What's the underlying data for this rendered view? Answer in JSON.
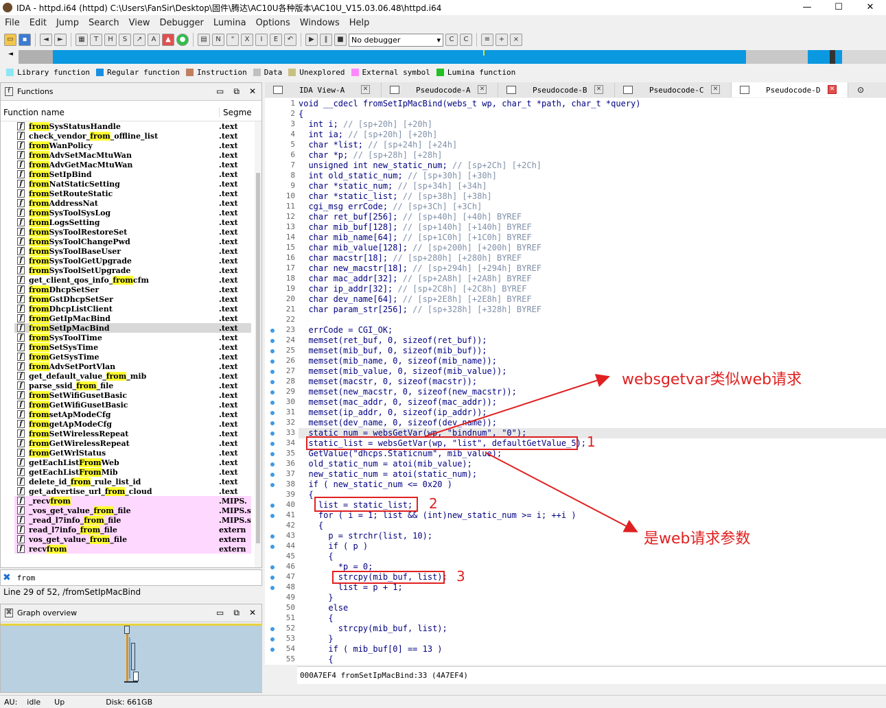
{
  "window": {
    "title": "IDA - httpd.i64 (httpd) C:\\Users\\FanSir\\Desktop\\固件\\腾达\\AC10U各种版本\\AC10U_V15.03.06.48\\httpd.i64"
  },
  "menu": [
    "File",
    "Edit",
    "Jump",
    "Search",
    "View",
    "Debugger",
    "Lumina",
    "Options",
    "Windows",
    "Help"
  ],
  "toolbar": {
    "debugger_select": "No debugger"
  },
  "legend": [
    {
      "label": "Library function",
      "color": "#8ee6f5"
    },
    {
      "label": "Regular function",
      "color": "#1a8fe0"
    },
    {
      "label": "Instruction",
      "color": "#c08060"
    },
    {
      "label": "Data",
      "color": "#c0c0c0"
    },
    {
      "label": "Unexplored",
      "color": "#c8c080"
    },
    {
      "label": "External symbol",
      "color": "#ff88ff"
    },
    {
      "label": "Lumina function",
      "color": "#22c022"
    }
  ],
  "functions_panel": {
    "title": "Functions",
    "col_name": "Function name",
    "col_segment": "Segme",
    "rows": [
      {
        "name": "fromSysStatusHandle",
        "seg": ".text"
      },
      {
        "name": "check_vendor_from_offline_list",
        "seg": ".text"
      },
      {
        "name": "fromWanPolicy",
        "seg": ".text"
      },
      {
        "name": "fromAdvSetMacMtuWan",
        "seg": ".text"
      },
      {
        "name": "fromAdvGetMacMtuWan",
        "seg": ".text"
      },
      {
        "name": "fromSetIpBind",
        "seg": ".text"
      },
      {
        "name": "fromNatStaticSetting",
        "seg": ".text"
      },
      {
        "name": "fromSetRouteStatic",
        "seg": ".text"
      },
      {
        "name": "fromAddressNat",
        "seg": ".text"
      },
      {
        "name": "fromSysToolSysLog",
        "seg": ".text"
      },
      {
        "name": "fromLogsSetting",
        "seg": ".text"
      },
      {
        "name": "fromSysToolRestoreSet",
        "seg": ".text"
      },
      {
        "name": "fromSysToolChangePwd",
        "seg": ".text"
      },
      {
        "name": "fromSysToolBaseUser",
        "seg": ".text"
      },
      {
        "name": "fromSysToolGetUpgrade",
        "seg": ".text"
      },
      {
        "name": "fromSysToolSetUpgrade",
        "seg": ".text"
      },
      {
        "name": "get_client_qos_info_fromcfm",
        "seg": ".text"
      },
      {
        "name": "fromDhcpSetSer",
        "seg": ".text"
      },
      {
        "name": "fromGstDhcpSetSer",
        "seg": ".text"
      },
      {
        "name": "fromDhcpListClient",
        "seg": ".text"
      },
      {
        "name": "fromGetIpMacBind",
        "seg": ".text"
      },
      {
        "name": "fromSetIpMacBind",
        "seg": ".text"
      },
      {
        "name": "fromSysToolTime",
        "seg": ".text"
      },
      {
        "name": "fromSetSysTime",
        "seg": ".text"
      },
      {
        "name": "fromGetSysTime",
        "seg": ".text"
      },
      {
        "name": "fromAdvSetPortVlan",
        "seg": ".text"
      },
      {
        "name": "get_default_value_from_mib",
        "seg": ".text"
      },
      {
        "name": "parse_ssid_from_file",
        "seg": ".text"
      },
      {
        "name": "fromSetWifiGusetBasic",
        "seg": ".text"
      },
      {
        "name": "fromGetWifiGusetBasic",
        "seg": ".text"
      },
      {
        "name": "fromsetApModeCfg",
        "seg": ".text"
      },
      {
        "name": "fromgetApModeCfg",
        "seg": ".text"
      },
      {
        "name": "fromSetWirelessRepeat",
        "seg": ".text"
      },
      {
        "name": "fromGetWirelessRepeat",
        "seg": ".text"
      },
      {
        "name": "fromGetWrlStatus",
        "seg": ".text"
      },
      {
        "name": "getEachListFromWeb",
        "seg": ".text"
      },
      {
        "name": "getEachListFromMib",
        "seg": ".text"
      },
      {
        "name": "delete_id_from_rule_list_id",
        "seg": ".text"
      },
      {
        "name": "get_advertise_url_from_cloud",
        "seg": ".text"
      },
      {
        "name": "_recvfrom",
        "seg": ".MIPS."
      },
      {
        "name": "_vos_get_value_from_file",
        "seg": ".MIPS.s"
      },
      {
        "name": "_read_l7info_from_file",
        "seg": ".MIPS.s"
      },
      {
        "name": "read_l7info_from_file",
        "seg": "extern"
      },
      {
        "name": "vos_get_value_from_file",
        "seg": "extern"
      },
      {
        "name": "recvfrom",
        "seg": "extern"
      }
    ]
  },
  "filter": {
    "value": "from"
  },
  "line_info": "Line 29 of 52, /fromSetIpMacBind",
  "graph_panel": {
    "title": "Graph overview"
  },
  "tabs": [
    {
      "label": "IDA View-A"
    },
    {
      "label": "Pseudocode-A"
    },
    {
      "label": "Pseudocode-B"
    },
    {
      "label": "Pseudocode-C"
    },
    {
      "label": "Pseudocode-D"
    }
  ],
  "code_lines": [
    "void __cdecl fromSetIpMacBind(webs_t wp, char_t *path, char_t *query)",
    "{",
    "  int i; // [sp+20h] [+20h]",
    "  int ia; // [sp+20h] [+20h]",
    "  char *list; // [sp+24h] [+24h]",
    "  char *p; // [sp+28h] [+28h]",
    "  unsigned int new_static_num; // [sp+2Ch] [+2Ch]",
    "  int old_static_num; // [sp+30h] [+30h]",
    "  char *static_num; // [sp+34h] [+34h]",
    "  char *static_list; // [sp+38h] [+38h]",
    "  cgi_msg errCode; // [sp+3Ch] [+3Ch]",
    "  char ret_buf[256]; // [sp+40h] [+40h] BYREF",
    "  char mib_buf[128]; // [sp+140h] [+140h] BYREF",
    "  char mib_name[64]; // [sp+1C0h] [+1C0h] BYREF",
    "  char mib_value[128]; // [sp+200h] [+200h] BYREF",
    "  char macstr[18]; // [sp+280h] [+280h] BYREF",
    "  char new_macstr[18]; // [sp+294h] [+294h] BYREF",
    "  char mac_addr[32]; // [sp+2A8h] [+2A8h] BYREF",
    "  char ip_addr[32]; // [sp+2C8h] [+2C8h] BYREF",
    "  char dev_name[64]; // [sp+2E8h] [+2E8h] BYREF",
    "  char param_str[256]; // [sp+328h] [+328h] BYREF",
    "",
    "  errCode = CGI_OK;",
    "  memset(ret_buf, 0, sizeof(ret_buf));",
    "  memset(mib_buf, 0, sizeof(mib_buf));",
    "  memset(mib_name, 0, sizeof(mib_name));",
    "  memset(mib_value, 0, sizeof(mib_value));",
    "  memset(macstr, 0, sizeof(macstr));",
    "  memset(new_macstr, 0, sizeof(new_macstr));",
    "  memset(mac_addr, 0, sizeof(mac_addr));",
    "  memset(ip_addr, 0, sizeof(ip_addr));",
    "  memset(dev_name, 0, sizeof(dev_name));",
    "  static_num = websGetVar(wp, \"bindnum\", \"0\");",
    "  static_list = websGetVar(wp, \"list\", defaultGetValue_5);",
    "  GetValue(\"dhcps.Staticnum\", mib_value);",
    "  old_static_num = atoi(mib_value);",
    "  new_static_num = atoi(static_num);",
    "  if ( new_static_num <= 0x20 )",
    "  {",
    "    list = static_list;",
    "    for ( i = 1; list && (int)new_static_num >= i; ++i )",
    "    {",
    "      p = strchr(list, 10);",
    "      if ( p )",
    "      {",
    "        *p = 0;",
    "        strcpy(mib_buf, list);",
    "        list = p + 1;",
    "      }",
    "      else",
    "      {",
    "        strcpy(mib_buf, list);",
    "      }",
    "      if ( mib_buf[0] == 13 )",
    "      {"
  ],
  "code_status": "000A7EF4 fromSetIpMacBind:33 (4A7EF4)",
  "annotations": {
    "note1": "websgetvar类似web请求",
    "note2": "是web请求参数",
    "n1": "1",
    "n2": "2",
    "n3": "3"
  },
  "statusbar": {
    "au": "AU:",
    "state": "idle",
    "dir": "Up",
    "disk": "Disk: 661GB"
  }
}
